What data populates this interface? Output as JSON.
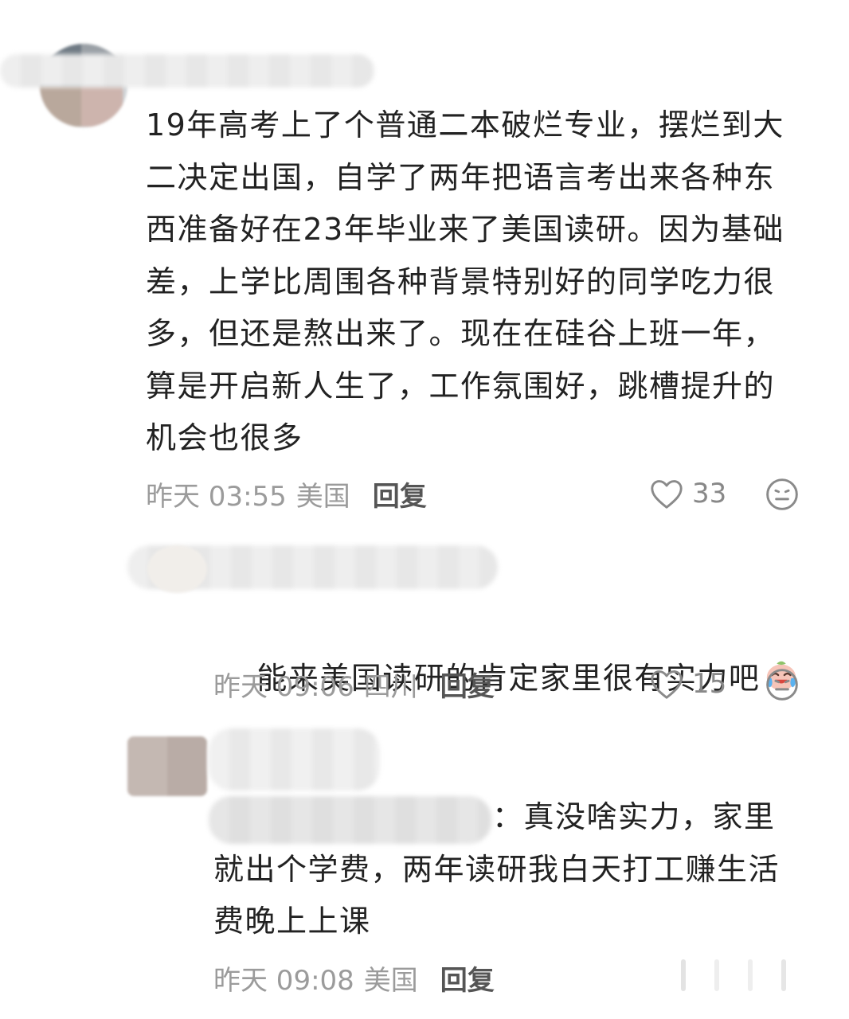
{
  "colors": {
    "text": "#222222",
    "meta": "#9b9b9b",
    "reply": "#555555",
    "blur": "#ececec"
  },
  "comments": [
    {
      "text": "19年高考上了个普通二本破烂专业，摆烂到大\n二决定出国，自学了两年把语言考出来各种东\n西准备好在23年毕业来了美国读研。因为基础\n差，上学比周围各种背景特别好的同学吃力很\n多，但还是熬出来了。现在在硅谷上班一年，\n算是开启新人生了，工作氛围好，跳槽提升的\n机会也很多",
      "time": "昨天 03:55",
      "location": "美国",
      "reply_label": "回复",
      "likes": "33",
      "like_icon": "heart-outline-icon",
      "dislike_icon": "meh-face-icon"
    },
    {
      "text": "能来美国读研的肯定家里很有实力吧",
      "emoji": "laugh-cry-emoji",
      "time": "昨天 09:06",
      "location": "四川",
      "reply_label": "回复",
      "likes": "15",
      "like_icon": "heart-outline-icon",
      "dislike_icon": "meh-face-icon"
    },
    {
      "text": "：真没啥实力，家里\n就出个学费，两年读研我白天打工赚生活\n费晚上上课",
      "time": "昨天 09:08",
      "location": "美国",
      "reply_label": "回复"
    }
  ]
}
